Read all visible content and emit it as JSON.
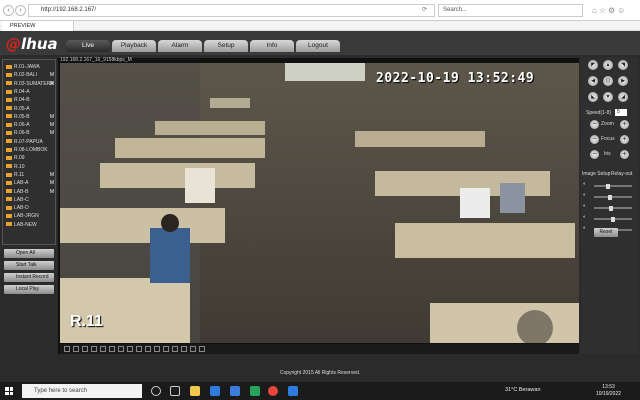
{
  "browser": {
    "url": "http://192.168.2.167/",
    "search_placeholder": "Search...",
    "tab_title": "PREVIEW"
  },
  "header": {
    "logo": "alhua",
    "tabs": [
      "Live",
      "Playback",
      "Alarm",
      "Setup",
      "Info",
      "Logout"
    ],
    "active_tab": "Live"
  },
  "channels": [
    {
      "name": "R.01-JAWA",
      "m": ""
    },
    {
      "name": "R.02-BALI",
      "m": "M"
    },
    {
      "name": "R.03-SUMATERA",
      "m": "M"
    },
    {
      "name": "R.04-A",
      "m": ""
    },
    {
      "name": "R.04-B",
      "m": ""
    },
    {
      "name": "R.05-A",
      "m": ""
    },
    {
      "name": "R.05-B",
      "m": "M"
    },
    {
      "name": "R.06-A",
      "m": "M"
    },
    {
      "name": "R.06-B",
      "m": "M"
    },
    {
      "name": "R.07-PAPUA",
      "m": ""
    },
    {
      "name": "R.08-LOMBOK",
      "m": ""
    },
    {
      "name": "R.09",
      "m": ""
    },
    {
      "name": "R.10",
      "m": ""
    },
    {
      "name": "R.11",
      "m": "M"
    },
    {
      "name": "LAB-A",
      "m": "M"
    },
    {
      "name": "LAB-B",
      "m": "M"
    },
    {
      "name": "LAB-C",
      "m": ""
    },
    {
      "name": "LAB-D",
      "m": ""
    },
    {
      "name": "LAB-JRGN",
      "m": ""
    },
    {
      "name": "LAB-NEW",
      "m": ""
    }
  ],
  "sidebar_buttons": [
    "Open All",
    "Start Talk",
    "Instant Record",
    "Local Play"
  ],
  "video": {
    "info": "192.168.2.167_16_9158kbps_M",
    "timestamp": "2022-10-19  13:52:49",
    "label": "R.11"
  },
  "ptz": {
    "speed_label": "Speed(1-8)",
    "speed_value": "5",
    "zoom": "Zoom",
    "focus": "Focus",
    "iris": "Iris",
    "image_setup": "Image Setup",
    "relay_out": "Relay-out",
    "reset": "Reset",
    "slider_levels": [
      0.35,
      0.4,
      0.45,
      0.5,
      0.5
    ]
  },
  "footer": {
    "copyright": "Copyright 2015 All Rights Reserved."
  },
  "taskbar": {
    "search_placeholder": "Type here to search",
    "weather": "31°C  Berawan",
    "time": "13:53",
    "date": "10/19/2022"
  },
  "colors": {
    "accent": "#d4231d",
    "channel_icon": "#e6a12f"
  }
}
